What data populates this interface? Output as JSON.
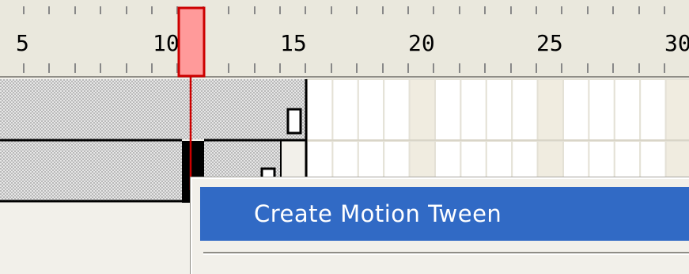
{
  "ruler": {
    "labels": [
      "5",
      "10",
      "15",
      "20",
      "25",
      "30"
    ]
  },
  "playhead": {
    "current_frame": 11,
    "color": "#ff9a9a",
    "line_color": "#cc0000"
  },
  "context_menu": {
    "items": [
      {
        "label": "Create Motion Tween",
        "highlighted": true
      }
    ],
    "highlight_color": "#316ac5"
  },
  "colors": {
    "ruler_bg": "#eae8dd",
    "panel_bg": "#f2f0ea",
    "frame_cell_bg": "#ffffff",
    "frame_cell_tinted": "#f0ece0"
  }
}
